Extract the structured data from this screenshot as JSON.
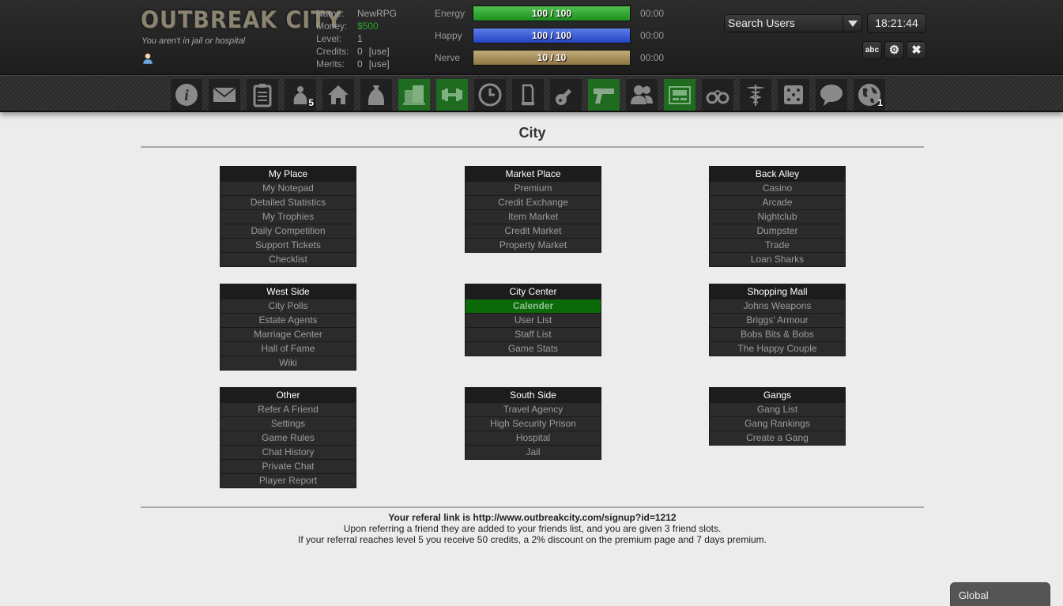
{
  "header": {
    "logo": "OUTBREAK CITY",
    "jail_status": "You aren't in jail or hospital",
    "stats": {
      "name_label": "Name:",
      "name": "NewRPG",
      "money_label": "Money:",
      "money": "$500",
      "level_label": "Level:",
      "level": "1",
      "credits_label": "Credits:",
      "credits": "0",
      "credits_use": "[use]",
      "merits_label": "Merits:",
      "merits": "0",
      "merits_use": "[use]"
    },
    "bars": [
      {
        "label": "Energy",
        "text": "100 / 100",
        "fraction": 1.0,
        "timer": "00:00",
        "color": "#2ea52e"
      },
      {
        "label": "Happy",
        "text": "100 / 100",
        "fraction": 1.0,
        "timer": "00:00",
        "color": "#3a5fd8"
      },
      {
        "label": "Nerve",
        "text": "10 / 10",
        "fraction": 1.0,
        "timer": "00:00",
        "color": "#a88f5c"
      }
    ],
    "search_select": "Search Users",
    "clock": "18:21:44",
    "buttons": {
      "abc": "abc",
      "gear": "⚙",
      "close": "✖"
    }
  },
  "nav": {
    "icons": [
      {
        "name": "info",
        "active": false
      },
      {
        "name": "mail",
        "active": false
      },
      {
        "name": "clipboard",
        "active": false
      },
      {
        "name": "money-bag",
        "active": false,
        "badge": "5"
      },
      {
        "name": "home",
        "active": false
      },
      {
        "name": "sack",
        "active": false
      },
      {
        "name": "city-buildings",
        "active": true
      },
      {
        "name": "dumbbell",
        "active": true
      },
      {
        "name": "clock",
        "active": false
      },
      {
        "name": "book",
        "active": false
      },
      {
        "name": "key",
        "active": false
      },
      {
        "name": "gun",
        "active": true
      },
      {
        "name": "users",
        "active": false
      },
      {
        "name": "newspaper",
        "active": true
      },
      {
        "name": "handcuffs",
        "active": false
      },
      {
        "name": "caduceus",
        "active": false
      },
      {
        "name": "dice",
        "active": false
      },
      {
        "name": "speech-bubble",
        "active": false
      },
      {
        "name": "globe",
        "active": false,
        "badge": "1"
      }
    ]
  },
  "main": {
    "title": "City",
    "menus": [
      {
        "title": "My Place",
        "items": [
          "My Notepad",
          "Detailed Statistics",
          "My Trophies",
          "Daily Competition",
          "Support Tickets",
          "Checklist"
        ]
      },
      {
        "title": "Market Place",
        "items": [
          "Premium",
          "Credit Exchange",
          "Item Market",
          "Credit Market",
          "Property Market"
        ]
      },
      {
        "title": "Back Alley",
        "items": [
          "Casino",
          "Arcade",
          "Nightclub",
          "Dumpster",
          "Trade",
          "Loan Sharks"
        ]
      },
      {
        "title": "West Side",
        "items": [
          "City Polls",
          "Estate Agents",
          "Marriage Center",
          "Hall of Fame",
          "Wiki"
        ]
      },
      {
        "title": "City Center",
        "items": [
          "Calender",
          "User List",
          "Staff List",
          "Game Stats"
        ],
        "active_index": 0
      },
      {
        "title": "Shopping Mall",
        "items": [
          "Johns Weapons",
          "Briggs' Armour",
          "Bobs Bits & Bobs",
          "The Happy Couple"
        ]
      },
      {
        "title": "Other",
        "items": [
          "Refer A Friend",
          "Settings",
          "Game Rules",
          "Chat History",
          "Private Chat",
          "Player Report"
        ]
      },
      {
        "title": "South Side",
        "items": [
          "Travel Agency",
          "High Security Prison",
          "Hospital",
          "Jail"
        ]
      },
      {
        "title": "Gangs",
        "items": [
          "Gang List",
          "Gang Rankings",
          "Create a Gang"
        ]
      }
    ]
  },
  "footer": {
    "referral": "Your referal link is http://www.outbreakcity.com/signup?id=1212",
    "line1": "Upon referring a friend they are added to your friends list, and you are given 3 friend slots.",
    "line2": "If your referral reaches level 5 you receive 50 credits, a 2% discount on the premium page and 7 days premium."
  },
  "chat": {
    "global_label": "Global"
  }
}
